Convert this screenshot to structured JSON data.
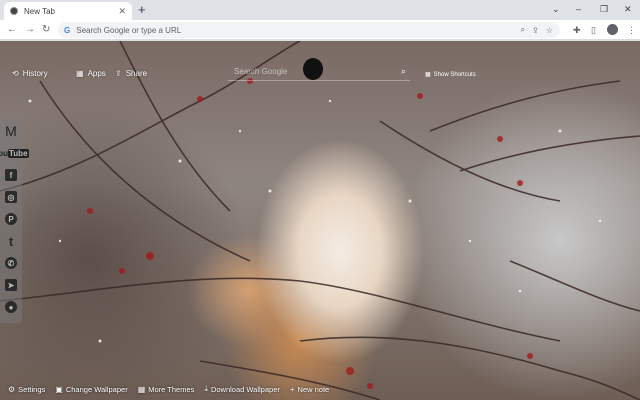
{
  "browser": {
    "tab": {
      "title": "New Tab",
      "close": "✕"
    },
    "new_tab": "+",
    "window_controls": {
      "dropdown": "⌄",
      "minimize": "–",
      "restore": "❐",
      "close": "✕"
    },
    "nav": {
      "back": "←",
      "forward": "→",
      "reload": "↻"
    },
    "omnibox": {
      "g": "G",
      "placeholder": "Search Google or type a URL"
    },
    "toolbar_icons": {
      "zoom": "⌕",
      "share": "⇪",
      "bookmark": "☆",
      "extensions": "✚",
      "sidepanel": "▯",
      "menu": "⋮"
    }
  },
  "page": {
    "top_links": [
      {
        "icon": "⟲",
        "label": "History"
      },
      {
        "icon": "▦",
        "label": "Apps"
      },
      {
        "icon": "⇪",
        "label": "Share"
      }
    ],
    "search": {
      "placeholder": "Search Google",
      "icon": "⌕"
    },
    "shortcuts": {
      "icon": "▦",
      "label": "Show Shortcuts"
    },
    "social": [
      {
        "name": "gmail-icon",
        "glyph": "M"
      },
      {
        "name": "youtube-icon",
        "glyph": "You",
        "glyph2": "Tube"
      },
      {
        "name": "facebook-icon",
        "glyph": "f"
      },
      {
        "name": "instagram-icon",
        "glyph": "◎"
      },
      {
        "name": "pinterest-icon",
        "glyph": "P"
      },
      {
        "name": "twitter-icon",
        "glyph": "t"
      },
      {
        "name": "whatsapp-icon",
        "glyph": "✆"
      },
      {
        "name": "telegram-icon",
        "glyph": "➤"
      },
      {
        "name": "reddit-icon",
        "glyph": "●"
      }
    ],
    "bottom": [
      {
        "icon": "⚙",
        "label": "Settings"
      },
      {
        "icon": "▣",
        "label": "Change Wallpaper"
      },
      {
        "icon": "▦",
        "label": "More Themes"
      },
      {
        "icon": "⤓",
        "label": "Download Wallpaper"
      },
      {
        "icon": "+",
        "label": "New note"
      }
    ]
  }
}
